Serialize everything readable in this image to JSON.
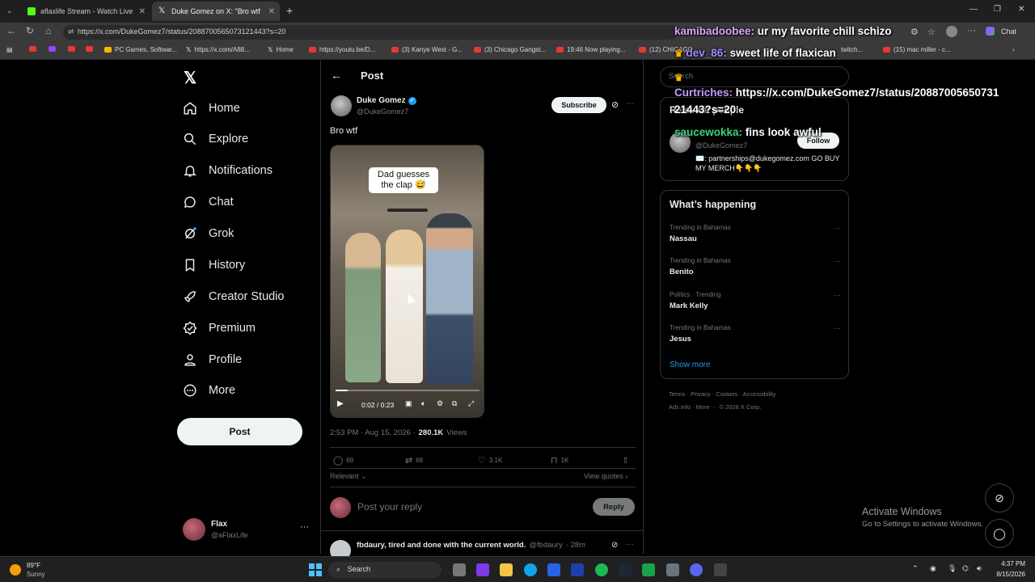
{
  "browser": {
    "tabs": [
      {
        "title": "aflaxlife Stream - Watch Live on Ki",
        "color": "#53fc18"
      },
      {
        "title": "Duke Gomez on X: \"Bro wtf h",
        "color": "#ffffff"
      }
    ],
    "url": "https://x.com/DukeGomez7/status/2088700565073121443?s=20",
    "chat_label": "Chat",
    "bookmarks": [
      "PC Games, Softwar...",
      "https://x.com/A88...",
      "Home",
      "https://youtu.be/D...",
      "(3) Kanye West - G...",
      "(3) Chicago Gangst...",
      "19:46 Now playing...",
      "(12) CHICAGO",
      "twitch...",
      "(15) mac miller - c..."
    ]
  },
  "sidebar": {
    "items": [
      {
        "label": "Home",
        "icon": "home-icon"
      },
      {
        "label": "Explore",
        "icon": "search-icon"
      },
      {
        "label": "Notifications",
        "icon": "bell-icon"
      },
      {
        "label": "Chat",
        "icon": "chat-icon"
      },
      {
        "label": "Grok",
        "icon": "grok-icon"
      },
      {
        "label": "History",
        "icon": "bookmark-icon"
      },
      {
        "label": "Creator Studio",
        "icon": "rocket-icon"
      },
      {
        "label": "Premium",
        "icon": "premium-icon"
      },
      {
        "label": "Profile",
        "icon": "person-icon"
      },
      {
        "label": "More",
        "icon": "more-circle-icon"
      }
    ],
    "post_button": "Post",
    "account": {
      "name": "Flax",
      "handle": "@aFlaxLife"
    }
  },
  "post": {
    "header_title": "Post",
    "author_name": "Duke Gomez",
    "author_handle": "@DukeGomez7",
    "subscribe_label": "Subscribe",
    "text": "Bro wtf",
    "video_caption_line1": "Dad guesses",
    "video_caption_line2": "the clap 😅",
    "video_time": "0:02 / 0:23",
    "video_progress": 0.087,
    "timestamp": "2:53 PM · Aug 15, 2026 ·",
    "views_count": "280.1K",
    "views_label": "Views",
    "replies": "69",
    "reposts": "68",
    "likes": "3.1K",
    "bookmarks": "1K",
    "sort_label": "Relevant",
    "view_quotes": "View quotes",
    "reply_placeholder": "Post your reply",
    "reply_button": "Reply",
    "next_reply": {
      "name": "fbdaury, tired and done with the current world.",
      "handle": "@fbdaury",
      "time": "· 28m"
    }
  },
  "right": {
    "search_placeholder": "Search",
    "relevant_title": "Relevant people",
    "relevant_person": {
      "handle": "@DukeGomez7",
      "bio": "✉️: partnerships@dukegomez.com GO BUY MY MERCH👇👇👇",
      "follow_label": "Follow"
    },
    "whats_happening_title": "What’s happening",
    "trends": [
      {
        "category": "Trending in Bahamas",
        "name": "Nassau"
      },
      {
        "category": "Trending in Bahamas",
        "name": "Benito"
      },
      {
        "category": "Politics · Trending",
        "name": "Mark Kelly"
      },
      {
        "category": "Trending in Bahamas",
        "name": "Jesus"
      }
    ],
    "show_more": "Show more",
    "footer_line1": "Terms · Privacy · Cookies · Accessibility ·",
    "footer_line2": "Ads info · More ··· © 2026 X Corp."
  },
  "stream_chat": [
    {
      "user": "kamibadoobee:",
      "msg": "ur my favorite chill schizo",
      "color": "#d9a5ff"
    },
    {
      "user": "dev_86:",
      "msg": "sweet life of flaxican",
      "color": "#a58bff"
    },
    {
      "user": "Curtriches:",
      "msg": "https://x.com/DukeGomez7/status/20887005650731",
      "color": "#c39bff"
    },
    {
      "user": "",
      "msg": "21443?s=20",
      "color": "#ffffff"
    },
    {
      "user": "saucewokka:",
      "msg": "fins look awful",
      "color": "#3bd47a"
    }
  ],
  "activate_windows": {
    "title": "Activate Windows",
    "subtitle": "Go to Settings to activate Windows."
  },
  "taskbar": {
    "weather_temp": "89°F",
    "weather_desc": "Sunny",
    "search_label": "Search",
    "time": "4:37 PM",
    "date": "8/15/2026"
  }
}
